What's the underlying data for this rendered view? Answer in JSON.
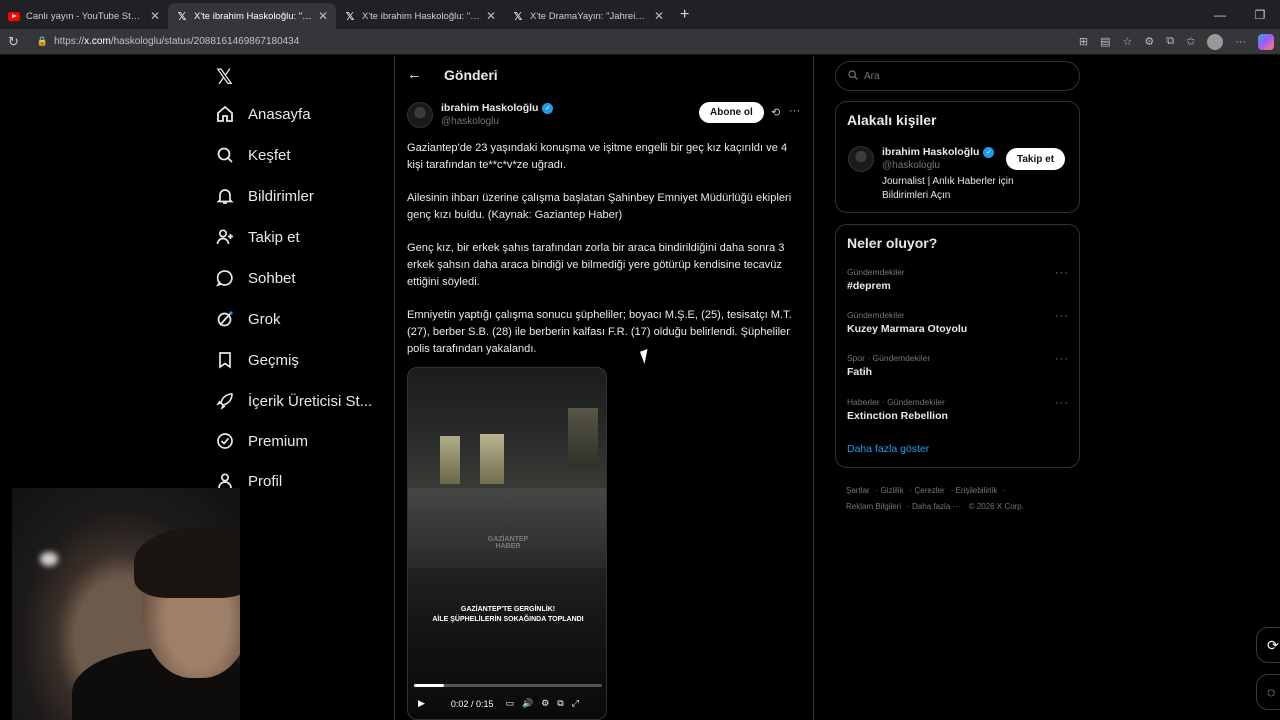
{
  "browser": {
    "tabs": [
      {
        "title": "Canlı yayın - YouTube Studio",
        "favicon": "youtube-icon",
        "active": false
      },
      {
        "title": "X'te ibrahim Haskoloğlu: \"Gaziantep",
        "favicon": "x-icon",
        "active": true
      },
      {
        "title": "X'te ibrahim Haskoloğlu: \"Türkiye'",
        "favicon": "x-icon",
        "active": false
      },
      {
        "title": "X'te DramaYayın: \"Jahrein, kendisini",
        "favicon": "x-icon",
        "active": false
      }
    ],
    "url_prefix": "https://",
    "url_host": "x.com",
    "url_path": "/haskologlu/status/2088161469867180434"
  },
  "nav": {
    "items": [
      {
        "label": "Anasayfa",
        "icon": "home-icon"
      },
      {
        "label": "Keşfet",
        "icon": "search-icon"
      },
      {
        "label": "Bildirimler",
        "icon": "bell-icon"
      },
      {
        "label": "Takip et",
        "icon": "add-person-icon"
      },
      {
        "label": "Sohbet",
        "icon": "chat-icon"
      },
      {
        "label": "Grok",
        "icon": "grok-icon"
      },
      {
        "label": "Geçmiş",
        "icon": "bookmark-icon"
      },
      {
        "label": "İçerik Üreticisi St...",
        "icon": "rocket-icon"
      },
      {
        "label": "Premium",
        "icon": "verified-badge-icon"
      },
      {
        "label": "Profil",
        "icon": "person-icon"
      }
    ]
  },
  "post": {
    "header_title": "Gönderi",
    "author_name": "ibrahim Haskoloğlu",
    "author_handle": "@haskologlu",
    "subscribe_label": "Abone ol",
    "paragraphs": [
      "Gaziantep'de 23 yaşındaki konuşma ve işitme engelli bir geç kız kaçırıldı ve 4 kişi tarafından te**c*v*ze uğradı.",
      "Ailesinin ihbarı üzerine çalışma başlatan Şahinbey Emniyet Müdürlüğü ekipleri genç kızı buldu.  (Kaynak: Gaziantep Haber)",
      "Genç kız, bir erkek şahıs tarafından zorla bir araca bindirildiğini daha sonra 3 erkek şahsın daha araca bindiği ve bilmediği yere götürüp kendisine tecavüz ettiğini söyledi.",
      "Emniyetin yaptığı çalışma sonucu şüpheliler; boyacı M.Ş.E, (25), tesisatçı M.T. (27), berber S.B. (28) ile berberin kalfası F.R. (17) olduğu belirlendi. Şüpheliler polis tarafından yakalandı."
    ],
    "video": {
      "watermark": "GAZİANTEP HABER",
      "caption_line1": "GAZİANTEP'TE GERGİNLİK!",
      "caption_line2": "AİLE ŞÜPHELİLERİN SOKAĞINDA TOPLANDI",
      "time": "0:02 / 0:15",
      "progress_fraction": 0.16
    }
  },
  "sidebar": {
    "search_placeholder": "Ara",
    "related_title": "Alakalı kişiler",
    "related_person": {
      "name": "ibrahim Haskoloğlu",
      "handle": "@haskologlu",
      "bio": "Journalist | Anlık Haberler için Bildirimleri Açın",
      "follow_label": "Takip et"
    },
    "trends_title": "Neler oluyor?",
    "trends": [
      {
        "category": "Gündemdekiler",
        "name": "#deprem"
      },
      {
        "category": "Gündemdekiler",
        "name": "Kuzey Marmara Otoyolu"
      },
      {
        "category": "Spor · Gündemdekiler",
        "name": "Fatih"
      },
      {
        "category": "Haberler · Gündemdekiler",
        "name": "Extinction Rebellion"
      }
    ],
    "show_more": "Daha fazla göster",
    "footer_line1": [
      "Şartlar",
      "Gizlilik",
      "Çerezler",
      "Erişilebilirlik"
    ],
    "footer_line2": [
      "Reklam Bilgileri",
      "Daha fazla ···",
      "© 2026 X Corp."
    ]
  },
  "colors": {
    "accent": "#1d9bf0",
    "background": "#000000",
    "text": "#e7e9ea",
    "muted": "#71767b"
  }
}
